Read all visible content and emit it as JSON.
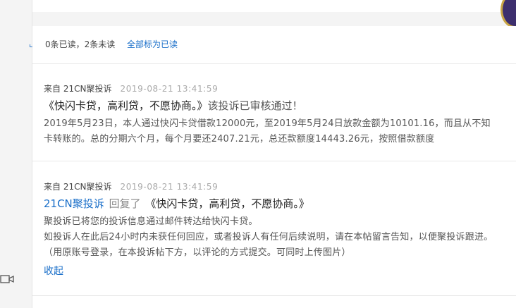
{
  "status_bar": {
    "read_count": "0条已读，2条未读",
    "mark_all_read": "全部标为已读"
  },
  "messages": [
    {
      "from": "来自  21CN聚投诉",
      "time": "2019-08-21 13:41:59",
      "title": "《快闪卡贷，高利贷，不愿协商。》",
      "status": "该投诉已审核通过！",
      "lines": [
        "2019年5月23日，本人通过快闪卡贷借款12000元，至2019年5月24日放款金额为10101.16，而且从不知",
        "卡转账的。总的分期六个月，每个月要还2407.21元，总还款额度14443.26元，按照借款额度"
      ]
    },
    {
      "from": "来自  21CN聚投诉",
      "time": "2019-08-21 13:41:59",
      "actor": "21CN聚投诉",
      "verb": "回复了",
      "title": "《快闪卡贷，高利贷，不愿协商。》",
      "lines": [
        "聚投诉已将您的投诉信息通过邮件转达给快闪卡贷。",
        "如投诉人在此后24小时内未获任何回应，或者投诉人有任何后续说明，请在本帖留言告知，以便聚投诉跟进。",
        "（用原账号登录，在本投诉帖下方，以评论的方式提交。可同时上传图片）"
      ],
      "collapse": "收起"
    }
  ],
  "icons": {
    "left_edge": "menu-edge-icon",
    "video": "video-camera-icon",
    "avatar": "user-avatar"
  }
}
